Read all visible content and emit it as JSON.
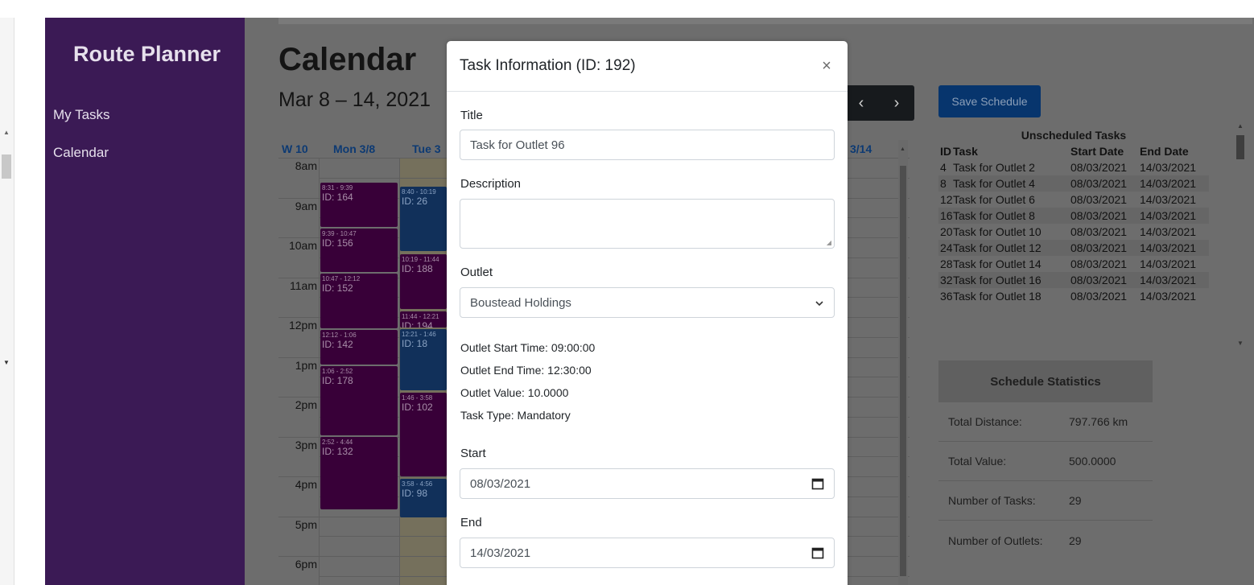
{
  "sidebar": {
    "brand": "Route Planner",
    "items": [
      {
        "label": "My Tasks"
      },
      {
        "label": "Calendar"
      }
    ]
  },
  "calendar": {
    "title": "Calendar",
    "range": "Mar 8 – 14, 2021",
    "nav_prev": "‹",
    "nav_next": "›",
    "week_label": "W 10",
    "columns": [
      "Mon 3/8",
      "Tue 3",
      "3/14"
    ],
    "times": [
      "8am",
      "9am",
      "10am",
      "11am",
      "12pm",
      "1pm",
      "2pm",
      "3pm",
      "4pm",
      "5pm",
      "6pm"
    ],
    "events_mon": [
      {
        "time": "8:31 - 9:39",
        "id": "ID: 164"
      },
      {
        "time": "9:39 - 10:47",
        "id": "ID: 156"
      },
      {
        "time": "10:47 - 12:12",
        "id": "ID: 152"
      },
      {
        "time": "12:12 - 1:06",
        "id": "ID: 142"
      },
      {
        "time": "1:06 - 2:52",
        "id": "ID: 178"
      },
      {
        "time": "2:52 - 4:44",
        "id": "ID: 132"
      }
    ],
    "events_tue": [
      {
        "time": "8:40 - 10:19",
        "id": "ID: 26"
      },
      {
        "time": "10:19 - 11:44",
        "id": "ID: 188"
      },
      {
        "time": "11:44 - 12:21",
        "id": "ID: 194"
      },
      {
        "time": "12:21 - 1:46",
        "id": "ID: 18"
      },
      {
        "time": "1:46 - 3:58",
        "id": "ID: 102"
      },
      {
        "time": "3:58 - 4:56",
        "id": "ID: 98"
      }
    ]
  },
  "toolbar": {
    "save_label": "Save Schedule"
  },
  "unscheduled": {
    "caption": "Unscheduled Tasks",
    "headers": [
      "ID",
      "Task",
      "Start Date",
      "End Date"
    ],
    "rows": [
      [
        "4",
        "Task for Outlet 2",
        "08/03/2021",
        "14/03/2021"
      ],
      [
        "8",
        "Task for Outlet 4",
        "08/03/2021",
        "14/03/2021"
      ],
      [
        "12",
        "Task for Outlet 6",
        "08/03/2021",
        "14/03/2021"
      ],
      [
        "16",
        "Task for Outlet 8",
        "08/03/2021",
        "14/03/2021"
      ],
      [
        "20",
        "Task for Outlet 10",
        "08/03/2021",
        "14/03/2021"
      ],
      [
        "24",
        "Task for Outlet 12",
        "08/03/2021",
        "14/03/2021"
      ],
      [
        "28",
        "Task for Outlet 14",
        "08/03/2021",
        "14/03/2021"
      ],
      [
        "32",
        "Task for Outlet 16",
        "08/03/2021",
        "14/03/2021"
      ],
      [
        "36",
        "Task for Outlet 18",
        "08/03/2021",
        "14/03/2021"
      ]
    ]
  },
  "stats": {
    "title": "Schedule Statistics",
    "rows": [
      {
        "label": "Total Distance:",
        "value": "797.766 km"
      },
      {
        "label": "Total Value:",
        "value": "500.0000"
      },
      {
        "label": "Number of Tasks:",
        "value": "29"
      },
      {
        "label": "Number of Outlets:",
        "value": "29"
      }
    ]
  },
  "modal": {
    "title": "Task Information (ID: 192)",
    "close": "×",
    "title_label": "Title",
    "title_value": "Task for Outlet 96",
    "description_label": "Description",
    "outlet_label": "Outlet",
    "outlet_value": "Boustead Holdings",
    "outlet_start": "Outlet Start Time: 09:00:00",
    "outlet_end": "Outlet End Time: 12:30:00",
    "outlet_value_text": "Outlet Value: 10.0000",
    "task_type": "Task Type: Mandatory",
    "start_label": "Start",
    "start_value": "08/03/2021",
    "end_label": "End",
    "end_value": "14/03/2021"
  }
}
